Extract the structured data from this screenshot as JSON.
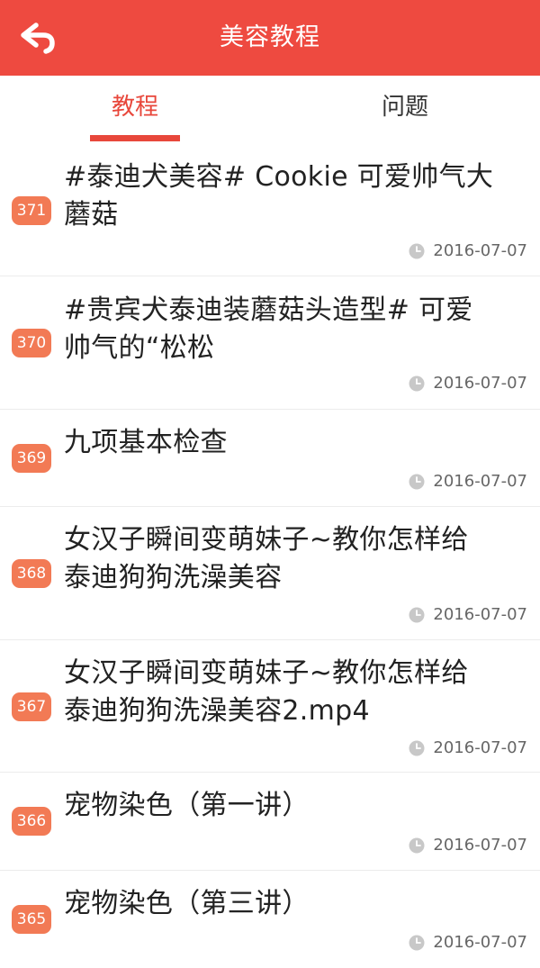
{
  "header": {
    "back_icon": "back-arrow-icon",
    "title": "美容教程",
    "accent_color": "#ee4a40"
  },
  "tabs": [
    {
      "label": "教程",
      "active": true
    },
    {
      "label": "问题",
      "active": false
    }
  ],
  "list": [
    {
      "number": "371",
      "title_lines": [
        "#泰迪犬美容# Cookie 可爱帅气大",
        "蘑菇"
      ],
      "date": "2016-07-07"
    },
    {
      "number": "370",
      "title_lines": [
        "#贵宾犬泰迪装蘑菇头造型#  可爱",
        "帅气的“松松"
      ],
      "date": "2016-07-07"
    },
    {
      "number": "369",
      "title_lines": [
        "九项基本检查"
      ],
      "date": "2016-07-07"
    },
    {
      "number": "368",
      "title_lines": [
        "女汉子瞬间变萌妹子~教你怎样给",
        "泰迪狗狗洗澡美容"
      ],
      "date": "2016-07-07"
    },
    {
      "number": "367",
      "title_lines": [
        "女汉子瞬间变萌妹子~教你怎样给",
        "泰迪狗狗洗澡美容2.mp4"
      ],
      "date": "2016-07-07"
    },
    {
      "number": "366",
      "title_lines": [
        "宠物染色（第一讲）"
      ],
      "date": "2016-07-07"
    },
    {
      "number": "365",
      "title_lines": [
        "宠物染色（第三讲）"
      ],
      "date": "2016-07-07"
    }
  ],
  "badge_color": "#f27a55",
  "date_icon": "clock-icon"
}
